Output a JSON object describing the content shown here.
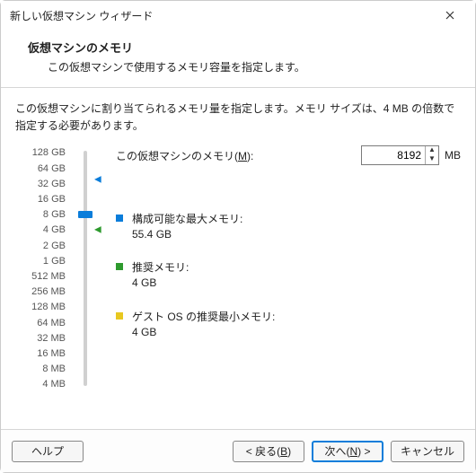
{
  "window": {
    "title": "新しい仮想マシン ウィザード"
  },
  "header": {
    "title": "仮想マシンのメモリ",
    "subtitle": "この仮想マシンで使用するメモリ容量を指定します。"
  },
  "instruction": "この仮想マシンに割り当てられるメモリ量を指定します。メモリ サイズは、4 MB の倍数で指定する必要があります。",
  "memory": {
    "field_label_pre": "この仮想マシンのメモリ(",
    "field_label_key": "M",
    "field_label_post": "):",
    "value": "8192",
    "unit": "MB",
    "scale": [
      "128 GB",
      "64 GB",
      "32 GB",
      "16 GB",
      "8 GB",
      "4 GB",
      "2 GB",
      "1 GB",
      "512 MB",
      "256 MB",
      "128 MB",
      "64 MB",
      "32 MB",
      "16 MB",
      "8 MB",
      "4 MB"
    ],
    "thumb_index": 4,
    "marks": {
      "max_index": 1.7,
      "rec_index": 5,
      "min_index": 5
    },
    "legends": {
      "max": {
        "title": "構成可能な最大メモリ:",
        "value": "55.4 GB"
      },
      "rec": {
        "title": "推奨メモリ:",
        "value": "4 GB"
      },
      "min": {
        "title": "ゲスト OS の推奨最小メモリ:",
        "value": "4 GB"
      }
    }
  },
  "buttons": {
    "help": "ヘルプ",
    "back_pre": "< 戻る(",
    "back_key": "B",
    "back_post": ")",
    "next_pre": "次へ(",
    "next_key": "N",
    "next_post": ") >",
    "cancel": "キャンセル"
  }
}
